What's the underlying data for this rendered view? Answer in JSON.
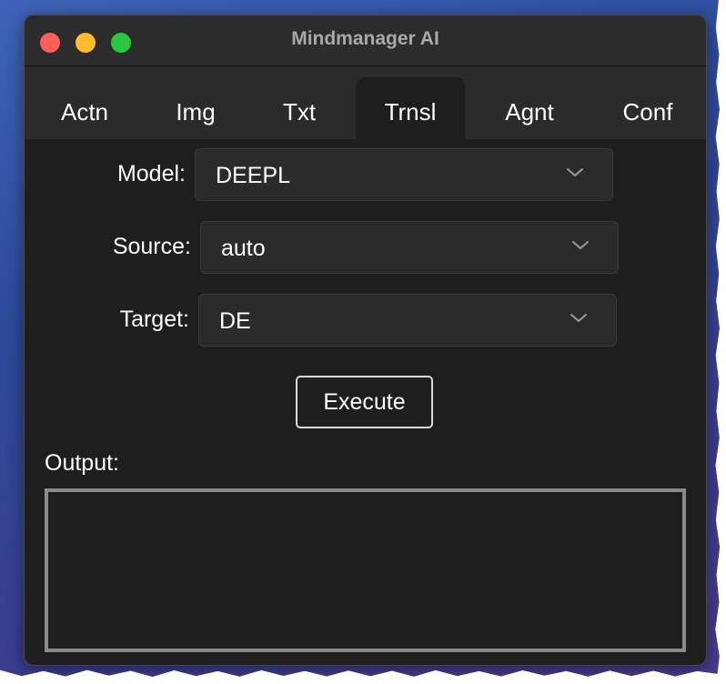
{
  "window": {
    "title": "Mindmanager AI"
  },
  "tabs": [
    {
      "label": "Actn",
      "active": false
    },
    {
      "label": "Img",
      "active": false
    },
    {
      "label": "Txt",
      "active": false
    },
    {
      "label": "Trnsl",
      "active": true
    },
    {
      "label": "Agnt",
      "active": false
    },
    {
      "label": "Conf",
      "active": false
    }
  ],
  "form": {
    "model": {
      "label": "Model:",
      "value": "DEEPL"
    },
    "source": {
      "label": "Source:",
      "value": "auto"
    },
    "target": {
      "label": "Target:",
      "value": "DE"
    }
  },
  "actions": {
    "execute_label": "Execute"
  },
  "output": {
    "label": "Output:",
    "value": ""
  },
  "icons": {
    "close": "close-icon",
    "minimize": "minimize-icon",
    "maximize": "maximize-icon",
    "dropdown": "chevron-down-icon"
  },
  "colors": {
    "close": "#ff5f57",
    "minimize": "#febc2e",
    "maximize": "#28c840",
    "window_bg": "#1e1e1e",
    "titlebar_bg": "#2c2c2c"
  }
}
